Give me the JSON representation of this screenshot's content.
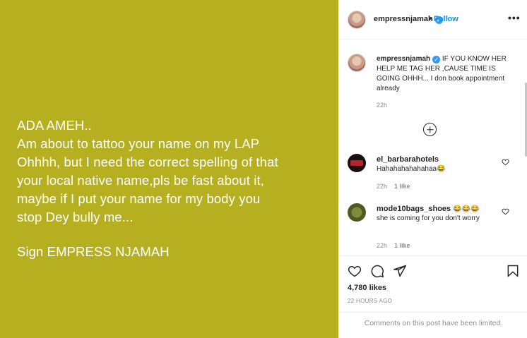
{
  "post": {
    "text_lines": [
      "ADA AMEH..",
      "Am about to tattoo your name on my LAP",
      "Ohhhh, but I need the correct spelling of that",
      "your local native name,pls be fast about it,",
      "maybe if I put your name for my body you",
      "stop Dey bully me..."
    ],
    "signature": "Sign EMPRESS NJAMAH",
    "background_color": "#b6b021"
  },
  "header": {
    "username": "empressnjamah",
    "verified_icon": "verified-badge-icon",
    "separator": "•",
    "follow_label": "Follow",
    "more_label": "•••"
  },
  "caption": {
    "username": "empressnjamah",
    "text": " IF YOU KNOW HER HELP ME TAG HER ,CAUSE TIME IS GOING OHHH... I don book appointment already",
    "time": "22h"
  },
  "comments": [
    {
      "username": "el_barbarahotels",
      "text": "Hahahahahahahaa",
      "emoji": "😂",
      "time": "22h",
      "likes": "1 like"
    },
    {
      "username": "mode10bags_shoes",
      "emoji": "😂😂😂",
      "text": "she is coming for you don't worry",
      "time": "22h",
      "likes": "1 like"
    }
  ],
  "actions": {
    "likes_count": "4,780 likes",
    "post_time": "22 HOURS AGO"
  },
  "footer": {
    "limited_text": "Comments on this post have been limited."
  },
  "colors": {
    "accent": "#0095f6",
    "verified": "#3897f0",
    "muted": "#8e8e8e"
  }
}
